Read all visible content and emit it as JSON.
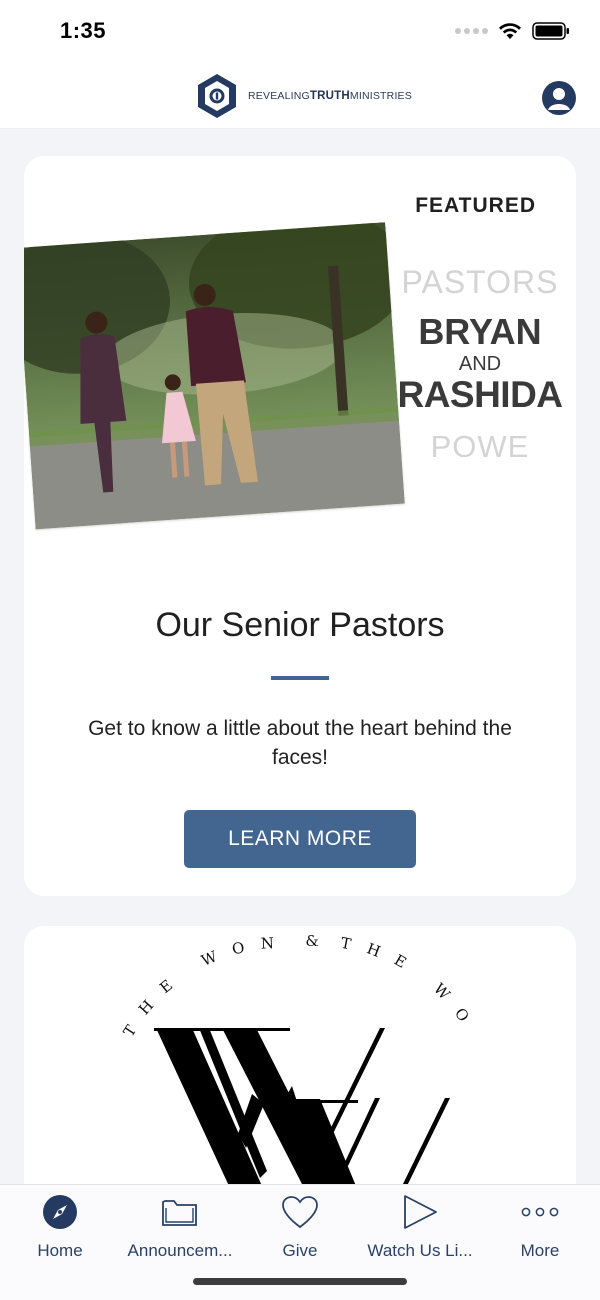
{
  "status": {
    "time": "1:35"
  },
  "header": {
    "brand_prefix": "REVEALING",
    "brand_bold": "TRUTH",
    "brand_suffix": "MINISTRIES"
  },
  "featured_card": {
    "tag": "FEATURED",
    "graphic_text": {
      "pastors": "PASTORS",
      "first_name": "BRYAN",
      "conjunction": "AND",
      "second_name": "RASHIDA",
      "surname": "POWE"
    },
    "title": "Our Senior Pastors",
    "description": "Get to know a little about the heart behind the faces!",
    "button_label": "LEARN MORE"
  },
  "second_card": {
    "arc_left": "THE WONDER",
    "arc_amp": "&",
    "arc_right": "THE WORK"
  },
  "tabs": [
    {
      "label": "Home",
      "icon": "compass-icon",
      "active": true
    },
    {
      "label": "Announcem...",
      "icon": "folder-icon"
    },
    {
      "label": "Give",
      "icon": "heart-icon"
    },
    {
      "label": "Watch Us Li...",
      "icon": "play-icon"
    },
    {
      "label": "More",
      "icon": "more-dots-icon"
    }
  ],
  "colors": {
    "accent": "#436690",
    "navy": "#243a60"
  }
}
